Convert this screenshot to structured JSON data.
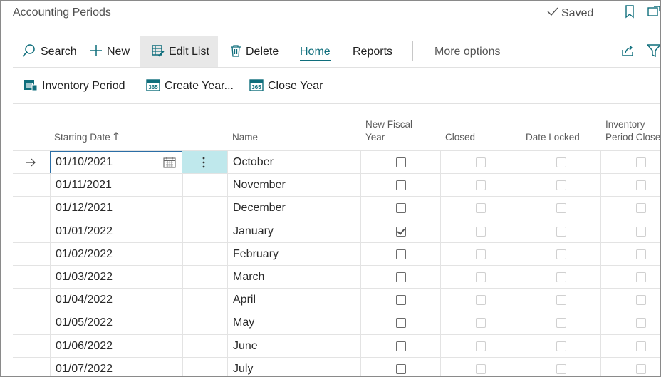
{
  "header": {
    "title": "Accounting Periods",
    "saved_label": "Saved"
  },
  "toolbar": {
    "search": "Search",
    "new": "New",
    "edit_list": "Edit List",
    "delete": "Delete",
    "home": "Home",
    "reports": "Reports",
    "more_options": "More options"
  },
  "actions": {
    "inventory_period": "Inventory Period",
    "create_year": "Create Year...",
    "close_year": "Close Year"
  },
  "columns": {
    "starting_date": "Starting Date",
    "name": "Name",
    "new_fiscal_year_1": "New Fiscal",
    "new_fiscal_year_2": "Year",
    "closed": "Closed",
    "date_locked": "Date Locked",
    "inventory_period_closed_1": "Inventory",
    "inventory_period_closed_2": "Period Closed"
  },
  "rows": [
    {
      "date": "01/10/2021",
      "name": "October",
      "new_fiscal_year": false
    },
    {
      "date": "01/11/2021",
      "name": "November",
      "new_fiscal_year": false
    },
    {
      "date": "01/12/2021",
      "name": "December",
      "new_fiscal_year": false
    },
    {
      "date": "01/01/2022",
      "name": "January",
      "new_fiscal_year": true
    },
    {
      "date": "01/02/2022",
      "name": "February",
      "new_fiscal_year": false
    },
    {
      "date": "01/03/2022",
      "name": "March",
      "new_fiscal_year": false
    },
    {
      "date": "01/04/2022",
      "name": "April",
      "new_fiscal_year": false
    },
    {
      "date": "01/05/2022",
      "name": "May",
      "new_fiscal_year": false
    },
    {
      "date": "01/06/2022",
      "name": "June",
      "new_fiscal_year": false
    },
    {
      "date": "01/07/2022",
      "name": "July",
      "new_fiscal_year": false
    }
  ],
  "colors": {
    "accent": "#0f6e7c",
    "selected_cell": "#bfe8ec",
    "focus_border": "#2b6ea6"
  }
}
